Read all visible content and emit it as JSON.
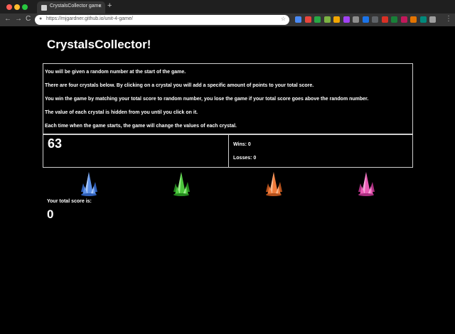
{
  "browser": {
    "tab_title": "CrystalsCollector game",
    "tab_close": "×",
    "new_tab": "+",
    "url": "https://mjgardner.github.io/unit-4-game/",
    "back": "←",
    "forward": "→",
    "reload": "C",
    "star": "☆",
    "menu": "⋮",
    "extension_colors": [
      "#4a8af4",
      "#e8453c",
      "#27a844",
      "#7cb342",
      "#f2a600",
      "#a142f4",
      "#8e8e8e",
      "#1a73e8",
      "#5f6368",
      "#d93025",
      "#188038",
      "#c2185b",
      "#e37400",
      "#00897b",
      "#9e9e9e"
    ]
  },
  "app": {
    "title": "CrystalsCollector!",
    "instructions": [
      "You will be given a random number at the start of the game.",
      "There are four crystals below. By clicking on a crystal you will add a specific amount of points to your total score.",
      "You win the game by matching your total score to random number, you lose the game if your total score goes above the random number.",
      "The value of each crystal is hidden from you until you click on it.",
      "Each time when the game starts, the game will change the values of each crystal."
    ],
    "target_number": "63",
    "wins_label": "Wins: 0",
    "losses_label": "Losses: 0",
    "crystals": [
      {
        "name": "blue",
        "color": "#5b8fe6",
        "light": "#a9c7f7",
        "dark": "#2f5fb8"
      },
      {
        "name": "green",
        "color": "#4cc63d",
        "light": "#9ef08e",
        "dark": "#258a1f"
      },
      {
        "name": "orange",
        "color": "#ee7a3a",
        "light": "#f7b58b",
        "dark": "#b4501b"
      },
      {
        "name": "pink",
        "color": "#e95bb4",
        "light": "#f6a6d8",
        "dark": "#aa2f80"
      }
    ],
    "score_label": "Your total score is:",
    "score_value": "0"
  }
}
